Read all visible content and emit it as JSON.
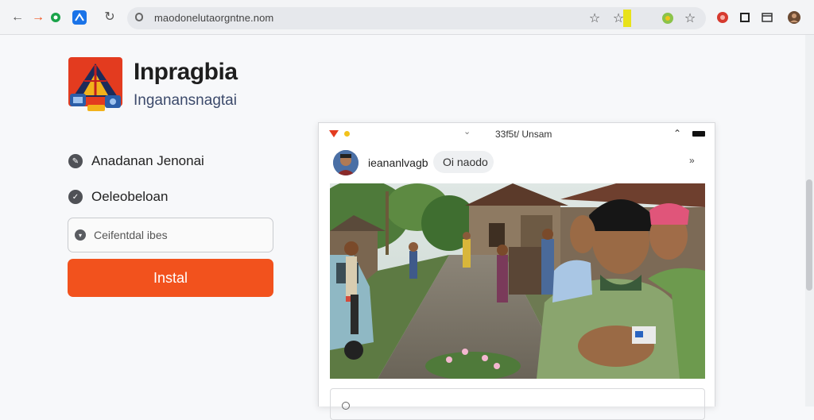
{
  "browser": {
    "url": "maodonelutaorgntne.nom",
    "icons": {
      "back": "back-arrow-icon",
      "forward": "forward-arrow-icon",
      "extension_green": "green-extension-icon",
      "extension_blue": "blue-extension-icon",
      "reload": "reload-icon",
      "lock": "lock-icon",
      "bookmark": "bookmark-star-icon",
      "bookmark_outline": "outline-star-icon",
      "profile": "profile-icon"
    },
    "colors": {
      "forward": "#f2521d",
      "green": "#1aa34a",
      "blue": "#1a73e8",
      "highlight": "#e8e21a"
    }
  },
  "app": {
    "title": "Inpragbia",
    "subtitle": "Inganansnagtai",
    "options": [
      {
        "label": "Anadanan Jenonai",
        "icon": "chat-icon"
      },
      {
        "label": "Oeleobeloan",
        "icon": "check-circle-icon"
      }
    ],
    "field_value": "Ceifentdal ibes",
    "install_label": "Instal",
    "accent": "#f2521d"
  },
  "preview": {
    "status_time": "33f5t/ Unsam",
    "profile_name": "ieananlvagb",
    "chip_label": "Oi naodo",
    "more_label": "»"
  }
}
